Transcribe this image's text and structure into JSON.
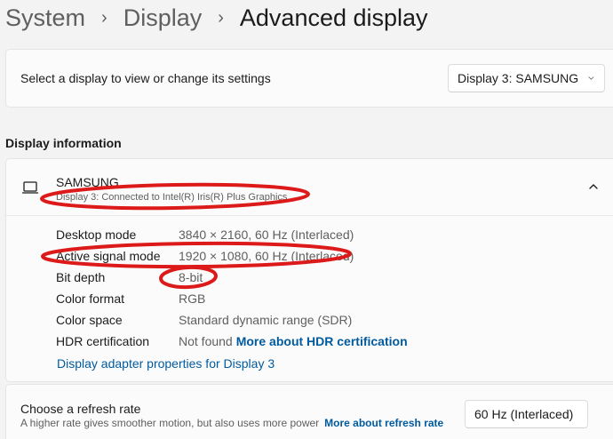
{
  "breadcrumb": {
    "items": [
      "System",
      "Display"
    ],
    "current": "Advanced display"
  },
  "display_selector": {
    "label": "Select a display to view or change its settings",
    "selected": "Display 3: SAMSUNG"
  },
  "display_info": {
    "section_title": "Display information",
    "name": "SAMSUNG",
    "subtitle": "Display 3: Connected to Intel(R) Iris(R) Plus Graphics",
    "rows": [
      {
        "label": "Desktop mode",
        "value": "3840 × 2160, 60 Hz (Interlaced)"
      },
      {
        "label": "Active signal mode",
        "value": "1920 × 1080, 60 Hz (Interlaced)"
      },
      {
        "label": "Bit depth",
        "value": "8-bit"
      },
      {
        "label": "Color format",
        "value": "RGB"
      },
      {
        "label": "Color space",
        "value": "Standard dynamic range (SDR)"
      },
      {
        "label": "HDR certification",
        "value": "Not found",
        "link": "More about HDR certification"
      }
    ],
    "adapter_link": "Display adapter properties for Display 3"
  },
  "refresh_rate": {
    "title": "Choose a refresh rate",
    "description": "A higher rate gives smoother motion, but also uses more power",
    "link": "More about refresh rate",
    "selected": "60 Hz (Interlaced)"
  },
  "colors": {
    "accent_link": "#005a9e",
    "annotation": "#dd1a1a"
  },
  "icons": {
    "separator": "chevron-right-icon",
    "dropdown": "chevron-down-icon",
    "collapse": "chevron-up-icon",
    "display": "monitor-icon"
  }
}
